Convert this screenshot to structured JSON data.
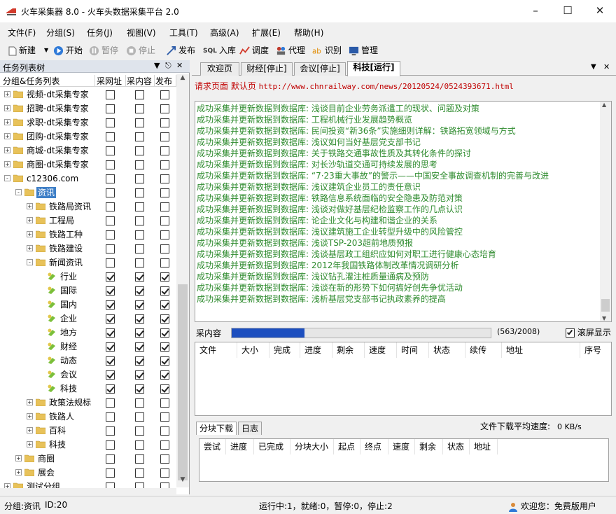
{
  "window": {
    "title": "火车采集器 8.0 - 火车头数据采集平台 2.0"
  },
  "menu": [
    "文件(F)",
    "分组(S)",
    "任务(J)",
    "视图(V)",
    "工具(T)",
    "高级(A)",
    "扩展(E)",
    "帮助(H)"
  ],
  "toolbar": {
    "new": "新建",
    "start": "开始",
    "pause": "暂停",
    "stop": "停止",
    "publish": "发布",
    "import": "入库",
    "schedule": "调度",
    "proxy": "代理",
    "recognize": "识别",
    "manage": "管理"
  },
  "left_pane": {
    "title": "任务列表树",
    "col_name": "分组&任务列表",
    "col_url": "采网址",
    "col_content": "采内容",
    "col_publish": "发布",
    "rows": [
      {
        "label": "视频-dt采集专家",
        "level": 0,
        "expand": "+",
        "type": "folder",
        "url": false,
        "content": false,
        "pub": false
      },
      {
        "label": "招聘-dt采集专家",
        "level": 0,
        "expand": "+",
        "type": "folder",
        "url": false,
        "content": false,
        "pub": false
      },
      {
        "label": "求职-dt采集专家",
        "level": 0,
        "expand": "+",
        "type": "folder",
        "url": false,
        "content": false,
        "pub": false
      },
      {
        "label": "团购-dt采集专家",
        "level": 0,
        "expand": "+",
        "type": "folder",
        "url": false,
        "content": false,
        "pub": false
      },
      {
        "label": "商城-dt采集专家",
        "level": 0,
        "expand": "+",
        "type": "folder",
        "url": false,
        "content": false,
        "pub": false
      },
      {
        "label": "商圈-dt采集专家",
        "level": 0,
        "expand": "+",
        "type": "folder",
        "url": false,
        "content": false,
        "pub": false
      },
      {
        "label": "c12306.com",
        "level": 0,
        "expand": "-",
        "type": "folder",
        "url": false,
        "content": false,
        "pub": false
      },
      {
        "label": "资讯",
        "level": 1,
        "expand": "-",
        "type": "folder",
        "url": false,
        "content": false,
        "pub": false,
        "selected": true
      },
      {
        "label": "铁路局资讯",
        "level": 2,
        "expand": "+",
        "type": "folder",
        "url": false,
        "content": false,
        "pub": false
      },
      {
        "label": "工程局",
        "level": 2,
        "expand": "+",
        "type": "folder",
        "url": false,
        "content": false,
        "pub": false
      },
      {
        "label": "铁路工种",
        "level": 2,
        "expand": "+",
        "type": "folder",
        "url": false,
        "content": false,
        "pub": false
      },
      {
        "label": "铁路建设",
        "level": 2,
        "expand": "+",
        "type": "folder",
        "url": false,
        "content": false,
        "pub": false
      },
      {
        "label": "新闻资讯",
        "level": 2,
        "expand": "-",
        "type": "folder",
        "url": false,
        "content": false,
        "pub": false
      },
      {
        "label": "行业",
        "level": 3,
        "expand": "",
        "type": "task",
        "url": true,
        "content": true,
        "pub": true
      },
      {
        "label": "国际",
        "level": 3,
        "expand": "",
        "type": "task",
        "url": true,
        "content": true,
        "pub": true
      },
      {
        "label": "国内",
        "level": 3,
        "expand": "",
        "type": "task",
        "url": true,
        "content": true,
        "pub": true
      },
      {
        "label": "企业",
        "level": 3,
        "expand": "",
        "type": "task",
        "url": true,
        "content": true,
        "pub": true
      },
      {
        "label": "地方",
        "level": 3,
        "expand": "",
        "type": "task",
        "url": true,
        "content": true,
        "pub": true
      },
      {
        "label": "财经",
        "level": 3,
        "expand": "",
        "type": "task",
        "url": true,
        "content": true,
        "pub": true
      },
      {
        "label": "动态",
        "level": 3,
        "expand": "",
        "type": "task",
        "url": true,
        "content": true,
        "pub": true
      },
      {
        "label": "会议",
        "level": 3,
        "expand": "",
        "type": "task",
        "url": true,
        "content": true,
        "pub": true
      },
      {
        "label": "科技",
        "level": 3,
        "expand": "",
        "type": "task",
        "url": true,
        "content": true,
        "pub": true
      },
      {
        "label": "政策法规标",
        "level": 2,
        "expand": "+",
        "type": "folder",
        "url": false,
        "content": false,
        "pub": false
      },
      {
        "label": "铁路人",
        "level": 2,
        "expand": "+",
        "type": "folder",
        "url": false,
        "content": false,
        "pub": false
      },
      {
        "label": "百科",
        "level": 2,
        "expand": "+",
        "type": "folder",
        "url": false,
        "content": false,
        "pub": false
      },
      {
        "label": "科技",
        "level": 2,
        "expand": "+",
        "type": "folder",
        "url": false,
        "content": false,
        "pub": false
      },
      {
        "label": "商圈",
        "level": 1,
        "expand": "+",
        "type": "folder",
        "url": false,
        "content": false,
        "pub": false
      },
      {
        "label": "展会",
        "level": 1,
        "expand": "+",
        "type": "folder",
        "url": false,
        "content": false,
        "pub": false
      },
      {
        "label": "测试分组",
        "level": 0,
        "expand": "+",
        "type": "folder",
        "url": false,
        "content": false,
        "pub": false
      }
    ]
  },
  "tabs": [
    "欢迎页",
    "财经[停止]",
    "会议[停止]",
    "科技[运行]"
  ],
  "request": {
    "label": "请求页面 默认页",
    "url": "http://www.chnrailway.com/news/20120524/0524393671.html"
  },
  "log_lines": [
    "成功采集并更新数据到数据库: 浅谈目前企业劳务派遣工的现状、问题及对策",
    "成功采集并更新数据到数据库: 工程机械行业发展趋势概览",
    "成功采集并更新数据到数据库: 民间投资“新36条”实施细则详解：铁路拓宽领域与方式",
    "成功采集并更新数据到数据库: 浅议如何当好基层党支部书记",
    "成功采集并更新数据到数据库: 关于铁路交通事故性质及其转化条件的探讨",
    "成功采集并更新数据到数据库: 对长沙轨道交通可持续发展的思考",
    "成功采集并更新数据到数据库: “7·23重大事故”的警示——中国安全事故调查机制的完善与改进",
    "成功采集并更新数据到数据库: 浅议建筑企业员工的责任意识",
    "成功采集并更新数据到数据库: 铁路信息系统面临的安全隐患及防范对策",
    "成功采集并更新数据到数据库: 浅谈对做好基层纪检监察工作的几点认识",
    "成功采集并更新数据到数据库: 论企业文化与构建和谐企业的关系",
    "成功采集并更新数据到数据库: 浅议建筑施工企业转型升级中的风险管控",
    "成功采集并更新数据到数据库: 浅谈TSP-203超前地质预报",
    "成功采集并更新数据到数据库: 浅谈基层政工组织应如何对职工进行健康心态培育",
    "成功采集并更新数据到数据库: 2012年我国铁路体制改革情况调研分析",
    "成功采集并更新数据到数据库: 浅议钻孔灌注桩质量通病及预防",
    "成功采集并更新数据到数据库: 浅谈在新的形势下如何搞好创先争优活动",
    "成功采集并更新数据到数据库: 浅析基层党支部书记执政素养的提高"
  ],
  "progress": {
    "label": "采内容",
    "done": 563,
    "total": 2008,
    "fraction": 0.28,
    "text": "(563/2008)",
    "scroll_label": "滚屏显示",
    "scroll_checked": true
  },
  "download_table": {
    "headers": [
      "文件",
      "大小",
      "完成",
      "进度",
      "剩余",
      "速度",
      "时间",
      "状态",
      "续传",
      "地址",
      "序号"
    ]
  },
  "subtabs": [
    "分块下载",
    "日志"
  ],
  "avg_speed": {
    "label": "文件下载平均速度:",
    "value": "0 KB/s"
  },
  "block_table": {
    "headers": [
      "尝试",
      "进度",
      "已完成",
      "分块大小",
      "起点",
      "终点",
      "速度",
      "剩余",
      "状态",
      "地址"
    ]
  },
  "status": {
    "group": "分组:资讯",
    "id": "ID:20",
    "counts": "运行中:1，就绪:0，暂停:0，停止:2",
    "user": "欢迎您：免费版用户"
  },
  "colors": {
    "accent": "#3f7fc7",
    "log_text": "#2e8b2e",
    "request_text": "#c00000",
    "progress_fill": "#1d4fbf",
    "folder": "#e8c25a"
  }
}
